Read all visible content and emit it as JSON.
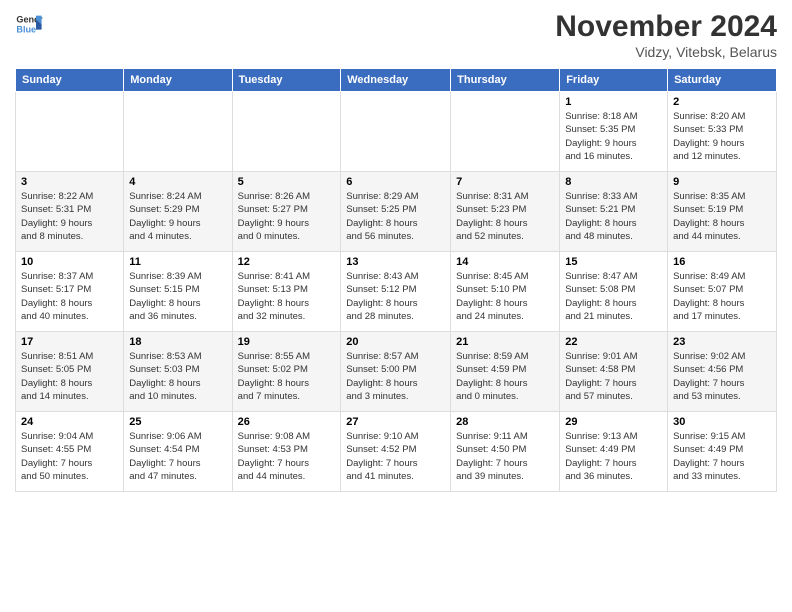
{
  "logo": {
    "line1": "General",
    "line2": "Blue"
  },
  "title": "November 2024",
  "subtitle": "Vidzy, Vitebsk, Belarus",
  "days_header": [
    "Sunday",
    "Monday",
    "Tuesday",
    "Wednesday",
    "Thursday",
    "Friday",
    "Saturday"
  ],
  "weeks": [
    [
      {
        "day": "",
        "info": ""
      },
      {
        "day": "",
        "info": ""
      },
      {
        "day": "",
        "info": ""
      },
      {
        "day": "",
        "info": ""
      },
      {
        "day": "",
        "info": ""
      },
      {
        "day": "1",
        "info": "Sunrise: 8:18 AM\nSunset: 5:35 PM\nDaylight: 9 hours\nand 16 minutes."
      },
      {
        "day": "2",
        "info": "Sunrise: 8:20 AM\nSunset: 5:33 PM\nDaylight: 9 hours\nand 12 minutes."
      }
    ],
    [
      {
        "day": "3",
        "info": "Sunrise: 8:22 AM\nSunset: 5:31 PM\nDaylight: 9 hours\nand 8 minutes."
      },
      {
        "day": "4",
        "info": "Sunrise: 8:24 AM\nSunset: 5:29 PM\nDaylight: 9 hours\nand 4 minutes."
      },
      {
        "day": "5",
        "info": "Sunrise: 8:26 AM\nSunset: 5:27 PM\nDaylight: 9 hours\nand 0 minutes."
      },
      {
        "day": "6",
        "info": "Sunrise: 8:29 AM\nSunset: 5:25 PM\nDaylight: 8 hours\nand 56 minutes."
      },
      {
        "day": "7",
        "info": "Sunrise: 8:31 AM\nSunset: 5:23 PM\nDaylight: 8 hours\nand 52 minutes."
      },
      {
        "day": "8",
        "info": "Sunrise: 8:33 AM\nSunset: 5:21 PM\nDaylight: 8 hours\nand 48 minutes."
      },
      {
        "day": "9",
        "info": "Sunrise: 8:35 AM\nSunset: 5:19 PM\nDaylight: 8 hours\nand 44 minutes."
      }
    ],
    [
      {
        "day": "10",
        "info": "Sunrise: 8:37 AM\nSunset: 5:17 PM\nDaylight: 8 hours\nand 40 minutes."
      },
      {
        "day": "11",
        "info": "Sunrise: 8:39 AM\nSunset: 5:15 PM\nDaylight: 8 hours\nand 36 minutes."
      },
      {
        "day": "12",
        "info": "Sunrise: 8:41 AM\nSunset: 5:13 PM\nDaylight: 8 hours\nand 32 minutes."
      },
      {
        "day": "13",
        "info": "Sunrise: 8:43 AM\nSunset: 5:12 PM\nDaylight: 8 hours\nand 28 minutes."
      },
      {
        "day": "14",
        "info": "Sunrise: 8:45 AM\nSunset: 5:10 PM\nDaylight: 8 hours\nand 24 minutes."
      },
      {
        "day": "15",
        "info": "Sunrise: 8:47 AM\nSunset: 5:08 PM\nDaylight: 8 hours\nand 21 minutes."
      },
      {
        "day": "16",
        "info": "Sunrise: 8:49 AM\nSunset: 5:07 PM\nDaylight: 8 hours\nand 17 minutes."
      }
    ],
    [
      {
        "day": "17",
        "info": "Sunrise: 8:51 AM\nSunset: 5:05 PM\nDaylight: 8 hours\nand 14 minutes."
      },
      {
        "day": "18",
        "info": "Sunrise: 8:53 AM\nSunset: 5:03 PM\nDaylight: 8 hours\nand 10 minutes."
      },
      {
        "day": "19",
        "info": "Sunrise: 8:55 AM\nSunset: 5:02 PM\nDaylight: 8 hours\nand 7 minutes."
      },
      {
        "day": "20",
        "info": "Sunrise: 8:57 AM\nSunset: 5:00 PM\nDaylight: 8 hours\nand 3 minutes."
      },
      {
        "day": "21",
        "info": "Sunrise: 8:59 AM\nSunset: 4:59 PM\nDaylight: 8 hours\nand 0 minutes."
      },
      {
        "day": "22",
        "info": "Sunrise: 9:01 AM\nSunset: 4:58 PM\nDaylight: 7 hours\nand 57 minutes."
      },
      {
        "day": "23",
        "info": "Sunrise: 9:02 AM\nSunset: 4:56 PM\nDaylight: 7 hours\nand 53 minutes."
      }
    ],
    [
      {
        "day": "24",
        "info": "Sunrise: 9:04 AM\nSunset: 4:55 PM\nDaylight: 7 hours\nand 50 minutes."
      },
      {
        "day": "25",
        "info": "Sunrise: 9:06 AM\nSunset: 4:54 PM\nDaylight: 7 hours\nand 47 minutes."
      },
      {
        "day": "26",
        "info": "Sunrise: 9:08 AM\nSunset: 4:53 PM\nDaylight: 7 hours\nand 44 minutes."
      },
      {
        "day": "27",
        "info": "Sunrise: 9:10 AM\nSunset: 4:52 PM\nDaylight: 7 hours\nand 41 minutes."
      },
      {
        "day": "28",
        "info": "Sunrise: 9:11 AM\nSunset: 4:50 PM\nDaylight: 7 hours\nand 39 minutes."
      },
      {
        "day": "29",
        "info": "Sunrise: 9:13 AM\nSunset: 4:49 PM\nDaylight: 7 hours\nand 36 minutes."
      },
      {
        "day": "30",
        "info": "Sunrise: 9:15 AM\nSunset: 4:49 PM\nDaylight: 7 hours\nand 33 minutes."
      }
    ]
  ]
}
